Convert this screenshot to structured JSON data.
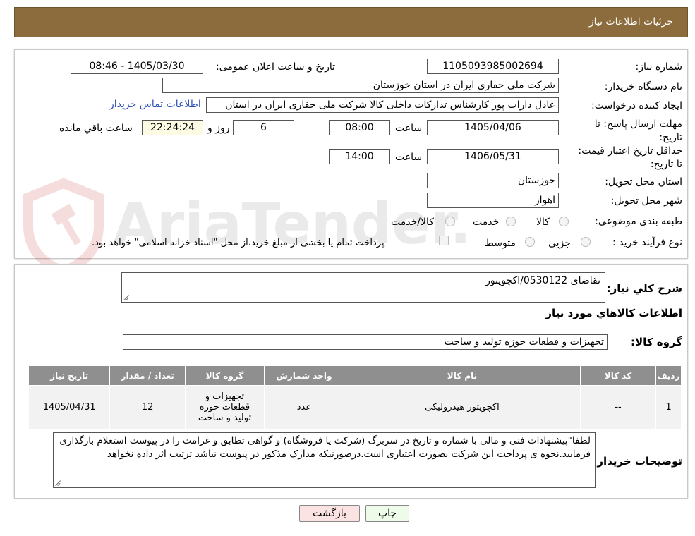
{
  "header": {
    "title": "جزئیات اطلاعات نیاز"
  },
  "form": {
    "need_number_label": "شماره نیاز:",
    "need_number": "1105093985002694",
    "announce_label": "تاریخ و ساعت اعلان عمومی:",
    "announce_value": "1405/03/30 - 08:46",
    "buyer_org_label": "نام دستگاه خریدار:",
    "buyer_org": "شرکت ملی حفاری ایران در استان خوزستان",
    "creator_label": "ایجاد کننده درخواست:",
    "creator": "عادل داراب پور کارشناس تدارکات داخلی کالا شرکت ملی حفاری ایران در استان",
    "contact_link": "اطلاعات تماس خریدار",
    "deadline_label": "مهلت ارسال پاسخ: تا تاریخ:",
    "deadline_date": "1405/04/06",
    "time_label": "ساعت",
    "deadline_time": "08:00",
    "days_value": "6",
    "days_label": "روز و",
    "remaining_time": "22:24:24",
    "remaining_label": "ساعت باقي مانده",
    "validity_label": "حداقل تاریخ اعتبار قیمت: تا تاریخ:",
    "validity_date": "1406/05/31",
    "validity_time": "14:00",
    "province_label": "استان محل تحویل:",
    "province": "خوزستان",
    "city_label": "شهر محل تحویل:",
    "city": "اهواز",
    "category_label": "طبقه بندی موضوعی:",
    "category_options": [
      "کالا",
      "خدمت",
      "کالا/خدمت"
    ],
    "process_label": "نوع فرآیند خرید :",
    "process_options": [
      "جزیی",
      "متوسط"
    ],
    "payment_note": "پرداخت تمام یا بخشی از مبلغ خرید،از محل \"اسناد خزانه اسلامی\" خواهد بود."
  },
  "description": {
    "label": "شرح كلي نياز:",
    "value": "تقاضای 0530122/اکچویتور"
  },
  "goods": {
    "section_title": "اطلاعات کالاهاي مورد نياز",
    "group_label": "گروه کالا:",
    "group_value": "تجهیزات و قطعات حوزه تولید و ساخت"
  },
  "table": {
    "headers": [
      "ردیف",
      "کد کالا",
      "نام کالا",
      "واحد شمارش",
      "گروه کالا",
      "تعداد / مقدار",
      "تاریخ نیاز"
    ],
    "rows": [
      [
        "1",
        "--",
        "اکچویتور هیدرولیکی",
        "عدد",
        "تجهیزات و قطعات حوزه تولید و ساخت",
        "12",
        "1405/04/31"
      ]
    ]
  },
  "buyer_notes": {
    "label": "توضیحات خریدار:",
    "value": "لطفا\"پیشنهادات فنی و مالی با شماره و تاریخ در سربرگ (شرکت یا فروشگاه) و گواهی تطابق و غرامت را در پیوست استعلام بارگذاری فرمایید.نحوه ی پرداخت این شرکت بصورت اعتباری است.درصورتیکه مدارک مذکور در پیوست نباشد ترتیب اثر داده نخواهد"
  },
  "buttons": {
    "print": "چاپ",
    "back": "بازگشت"
  },
  "watermark": {
    "text": "AriaTender.neT"
  }
}
